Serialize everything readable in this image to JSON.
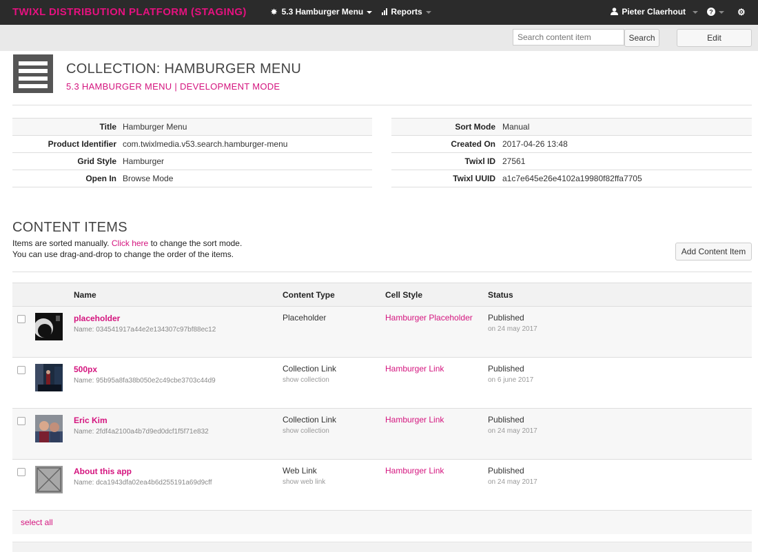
{
  "navbar": {
    "brand": "TWIXL DISTRIBUTION PLATFORM (STAGING)",
    "app_menu": "5.3 Hamburger Menu",
    "reports_menu": "Reports",
    "user_menu": "Pieter Claerhout",
    "help_icon": "question-circle-icon",
    "settings_icon": "gear-icon"
  },
  "toolbar": {
    "search_placeholder": "Search content item",
    "search_button": "Search",
    "edit_button": "Edit"
  },
  "header": {
    "icon": "hamburger-menu-icon",
    "title": "COLLECTION: HAMBURGER MENU",
    "subtitle": "5.3 HAMBURGER MENU | DEVELOPMENT MODE"
  },
  "properties_left": [
    {
      "label": "Title",
      "value": "Hamburger Menu"
    },
    {
      "label": "Product Identifier",
      "value": "com.twixlmedia.v53.search.hamburger-menu"
    },
    {
      "label": "Grid Style",
      "value": "Hamburger"
    },
    {
      "label": "Open In",
      "value": "Browse Mode"
    }
  ],
  "properties_right": [
    {
      "label": "Sort Mode",
      "value": "Manual"
    },
    {
      "label": "Created On",
      "value": "2017-04-26 13:48"
    },
    {
      "label": "Twixl ID",
      "value": "27561"
    },
    {
      "label": "Twixl UUID",
      "value": "a1c7e645e26e4102a19980f82ffa7705"
    }
  ],
  "content_items": {
    "title": "CONTENT ITEMS",
    "info_prefix": "Items are sorted manually.",
    "info_link": "Click here",
    "info_suffix": "to change the sort mode.",
    "info_line2": "You can use drag-and-drop to change the order of the items.",
    "add_button": "Add Content Item",
    "columns": {
      "name": "Name",
      "content_type": "Content Type",
      "cell_style": "Cell Style",
      "status": "Status"
    },
    "rows": [
      {
        "name": "placeholder",
        "id": "Name: 034541917a44e2e134307c97bf88ec12",
        "content_type": "Placeholder",
        "content_type_sub": "",
        "cell_style": "Hamburger Placeholder",
        "status": "Published",
        "status_date": "on 24 may 2017",
        "thumb": "dark-silhouette"
      },
      {
        "name": "500px",
        "id": "Name: 95b95a8fa38b050e2c49cbe3703c44d9",
        "content_type": "Collection Link",
        "content_type_sub": "show collection",
        "cell_style": "Hamburger Link",
        "status": "Published",
        "status_date": "on 6 june 2017",
        "thumb": "city-street"
      },
      {
        "name": "Eric Kim",
        "id": "Name: 2fdf4a2100a4b7d9ed0dcf1f5f71e832",
        "content_type": "Collection Link",
        "content_type_sub": "show collection",
        "cell_style": "Hamburger Link",
        "status": "Published",
        "status_date": "on 24 may 2017",
        "thumb": "people-photo"
      },
      {
        "name": "About this app",
        "id": "Name: dca1943dfa02ea4b6d255191a69d9cff",
        "content_type": "Web Link",
        "content_type_sub": "show web link",
        "cell_style": "Hamburger Link",
        "status": "Published",
        "status_date": "on 24 may 2017",
        "thumb": "no-image-placeholder"
      }
    ],
    "select_all": "select all"
  },
  "colors": {
    "accent": "#d4147e",
    "navbar": "#2b2b2b",
    "toolbar": "#e9e9e9"
  }
}
